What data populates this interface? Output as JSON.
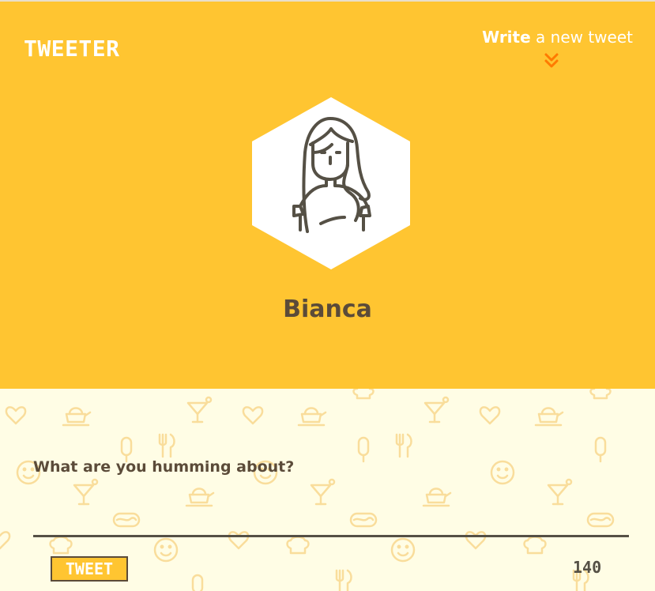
{
  "header": {
    "logo": "TWEETER",
    "write_link": {
      "bold": "Write",
      "rest": " a new tweet",
      "icon": "double-chevron-down-icon"
    }
  },
  "profile": {
    "avatar_icon": "woman-avatar-icon",
    "name": "Bianca"
  },
  "compose": {
    "prompt": "What are you humming about?",
    "input_value": "",
    "tweet_button": "TWEET",
    "char_count": "140",
    "background_pattern_icons": [
      "heart-icon",
      "teapot-icon",
      "cocktail-icon",
      "fork-knife-icon",
      "popsicle-icon",
      "smiley-icon",
      "hotdog-icon",
      "chef-hat-icon"
    ]
  },
  "colors": {
    "hero_bg": "#ffc531",
    "compose_bg": "#fffde5",
    "text_dark": "#5b4b39",
    "accent_orange": "#ff7a00",
    "white": "#ffffff"
  }
}
